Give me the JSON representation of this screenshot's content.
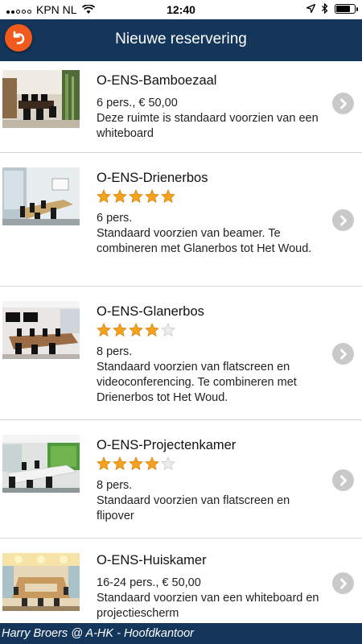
{
  "status_bar": {
    "carrier": "KPN NL",
    "time": "12:40",
    "battery_level": 0.85
  },
  "header": {
    "title": "Nieuwe reservering",
    "back_icon": "back-arrow-icon",
    "accent_color": "#f05a1c",
    "bar_color": "#14365a"
  },
  "rooms": [
    {
      "name": "O-ENS-Bamboezaal",
      "rating": null,
      "info": "6 pers., € 50,00",
      "description": "Deze ruimte is standaard voorzien van een whiteboard"
    },
    {
      "name": "O-ENS-Drienerbos",
      "rating": 5,
      "info": "6 pers.",
      "description": "Standaard voorzien van beamer. Te combineren met Glanerbos tot Het Woud."
    },
    {
      "name": "O-ENS-Glanerbos",
      "rating": 4,
      "info": "8 pers.",
      "description": "Standaard voorzien van flatscreen en videoconferencing. Te combineren met Drienerbos tot Het Woud."
    },
    {
      "name": "O-ENS-Projectenkamer",
      "rating": 4,
      "info": "8 pers.",
      "description": "Standaard voorzien van flatscreen en flipover"
    },
    {
      "name": "O-ENS-Huiskamer",
      "rating": null,
      "info": "16-24 pers., € 50,00",
      "description": "Standaard voorzien van een whiteboard en projectiescherm"
    }
  ],
  "footer": {
    "text": "Harry Broers @ A-HK - Hoofdkantoor"
  }
}
